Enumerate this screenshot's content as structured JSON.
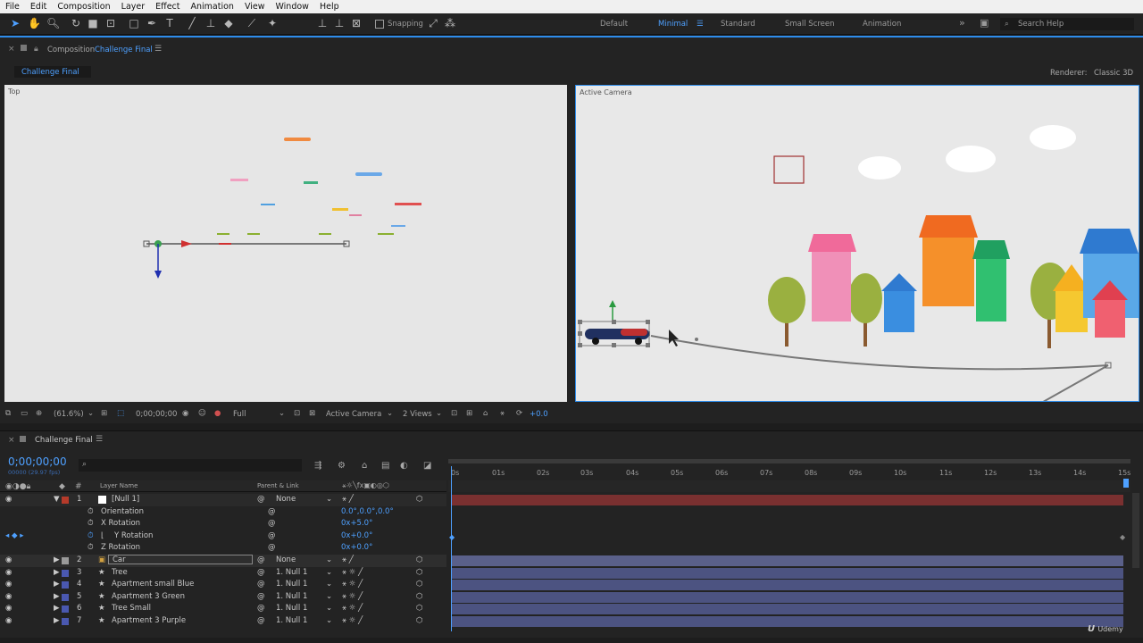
{
  "menu": [
    "File",
    "Edit",
    "Composition",
    "Layer",
    "Effect",
    "Animation",
    "View",
    "Window",
    "Help"
  ],
  "toolbar": {
    "snapping": "Snapping",
    "workspaces": [
      "Default",
      "Minimal",
      "Standard",
      "Small Screen",
      "Animation"
    ],
    "active_workspace": "Minimal",
    "search_placeholder": "Search Help"
  },
  "comp": {
    "panel_prefix": "Composition",
    "panel_name": "Challenge Final",
    "tab": "Challenge Final",
    "renderer_label": "Renderer:",
    "renderer_value": "Classic 3D",
    "left_view": "Top",
    "right_view": "Active Camera"
  },
  "viewer": {
    "zoom": "(61.6%)",
    "time": "0;00;00;00",
    "resolution": "Full",
    "camera": "Active Camera",
    "views": "2 Views",
    "exposure": "+0.0"
  },
  "timeline": {
    "tab": "Challenge Final",
    "timecode": "0;00;00;00",
    "fps": "00000 (29.97 fps)",
    "col_layer_name": "Layer Name",
    "col_parent": "Parent & Link",
    "ruler": [
      "0s",
      "01s",
      "02s",
      "03s",
      "04s",
      "05s",
      "06s",
      "07s",
      "08s",
      "09s",
      "10s",
      "11s",
      "12s",
      "13s",
      "14s",
      "15s"
    ],
    "layers": [
      {
        "num": "1",
        "name": "[Null 1]",
        "parent": "None",
        "color": "#b53a2a"
      },
      {
        "num": "2",
        "name": "Car",
        "parent": "None",
        "color": "#9a9a9a"
      },
      {
        "num": "3",
        "name": "Tree",
        "parent": "1. Null 1",
        "color": "#4a58b0"
      },
      {
        "num": "4",
        "name": "Apartment small Blue",
        "parent": "1. Null 1",
        "color": "#4a58b0"
      },
      {
        "num": "5",
        "name": "Apartment 3 Green",
        "parent": "1. Null 1",
        "color": "#4a58b0"
      },
      {
        "num": "6",
        "name": "Tree Small",
        "parent": "1. Null 1",
        "color": "#4a58b0"
      },
      {
        "num": "7",
        "name": "Apartment 3 Purple",
        "parent": "1. Null 1",
        "color": "#4a58b0"
      }
    ],
    "props": [
      {
        "name": "Orientation",
        "value": "0.0°,0.0°,0.0°"
      },
      {
        "name": "X Rotation",
        "value": "0x+5.0°"
      },
      {
        "name": "Y Rotation",
        "value": "0x+0.0°"
      },
      {
        "name": "Z Rotation",
        "value": "0x+0.0°"
      }
    ]
  },
  "watermark": "Udemy",
  "colors": {
    "accent": "#2d8ceb",
    "null_bar": "#7a3030",
    "layer_bar": "#4c5381"
  }
}
